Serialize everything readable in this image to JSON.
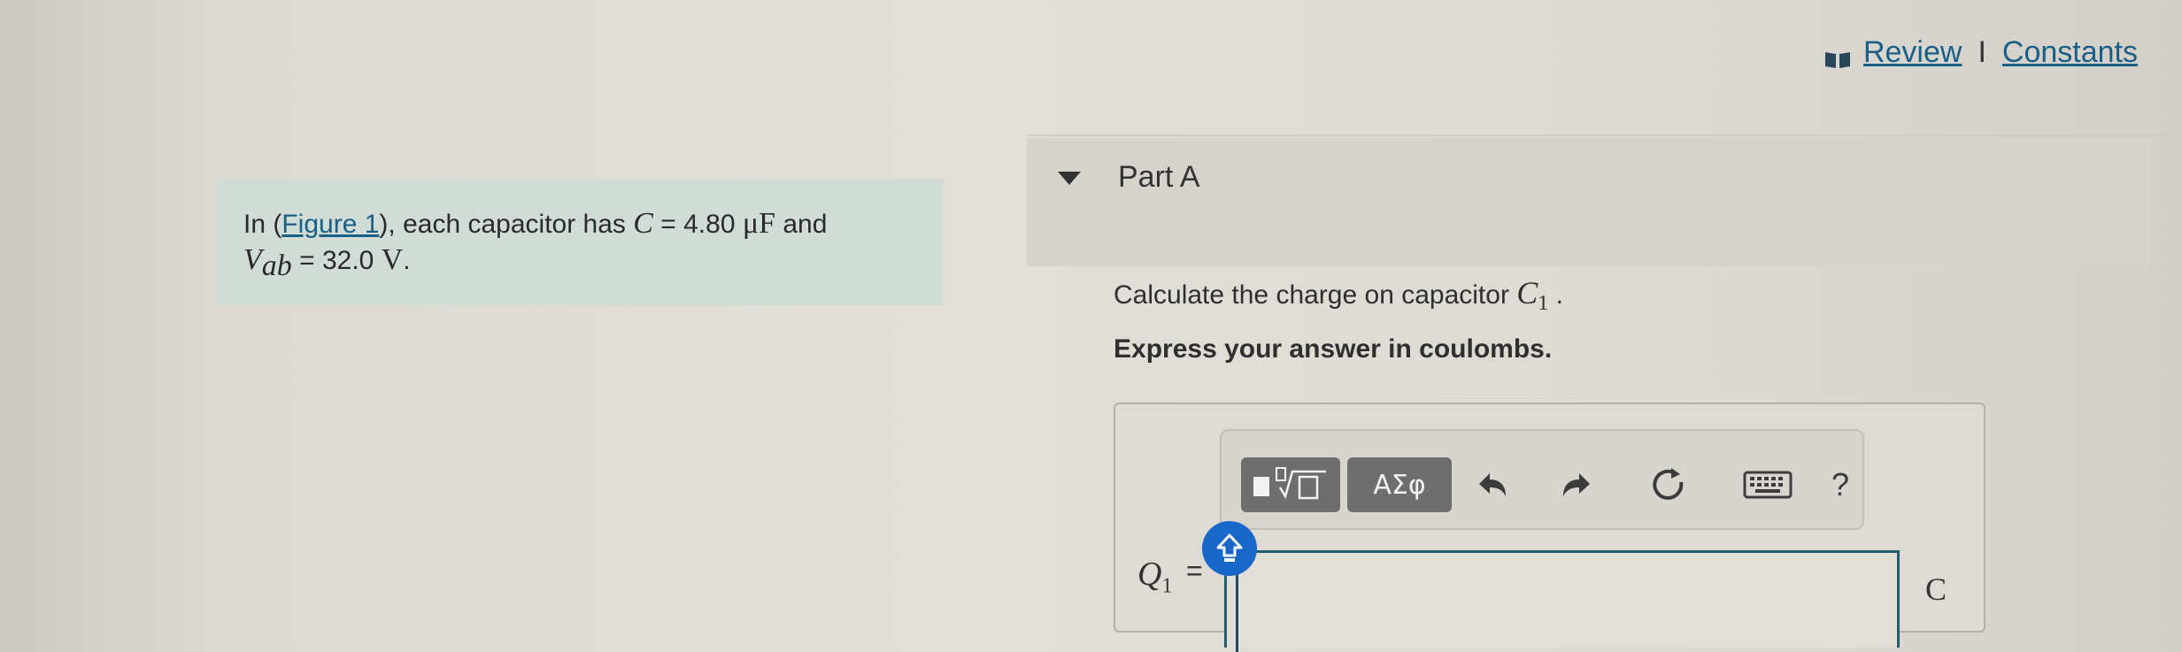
{
  "header": {
    "review_label": "Review",
    "separator": "I",
    "constants_label": "Constants"
  },
  "problem": {
    "prefix": "In (",
    "figure_link": "Figure 1",
    "suffix": "), each capacitor has",
    "c_var": "C",
    "c_eq": " = 4.80 ",
    "c_unit": "μF",
    "and": " and",
    "v_var": "V",
    "v_sub": "ab",
    "v_eq": " = 32.0 ",
    "v_unit": "V",
    "period": "."
  },
  "part": {
    "title": "Part A",
    "question_text": "Calculate the charge on capacitor ",
    "question_var": "C",
    "question_sub": "1",
    "question_end": " .",
    "instruction": "Express your answer in coulombs."
  },
  "toolbar": {
    "greek_label": "ΑΣφ",
    "help_label": "?"
  },
  "answer": {
    "var": "Q",
    "sub": "1",
    "equals": "=",
    "value": "",
    "unit": "C"
  },
  "colors": {
    "link": "#1a5f86",
    "shift_button": "#1768c8",
    "input_border": "#245d6f",
    "toolbar_button": "#6e6e6e"
  }
}
